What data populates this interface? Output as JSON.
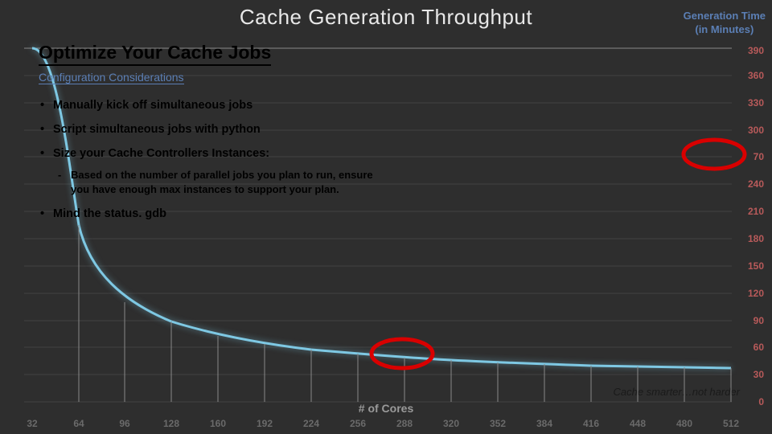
{
  "chart_data": {
    "type": "line",
    "title": "Cache Generation Throughput",
    "xlabel": "# of Cores",
    "ylabel": "Generation Time\n(in Minutes)",
    "x": [
      32,
      64,
      96,
      128,
      160,
      192,
      224,
      256,
      288,
      320,
      352,
      384,
      416,
      448,
      480,
      512
    ],
    "y_ticks": [
      0,
      30,
      60,
      90,
      120,
      150,
      180,
      210,
      240,
      270,
      300,
      330,
      360,
      390
    ],
    "ylim": [
      0,
      390
    ],
    "series": [
      {
        "name": "Generation Time",
        "x": [
          32,
          64,
          96,
          128,
          160,
          192,
          224,
          256,
          288,
          320,
          352,
          384,
          416,
          448,
          480,
          512
        ],
        "y": [
          390,
          195,
          140,
          110,
          92,
          80,
          72,
          66,
          61,
          57,
          54,
          51,
          48,
          46,
          44,
          42
        ]
      }
    ],
    "annotations": [
      {
        "shape": "ellipse",
        "approx_x": 256,
        "approx_y": 66
      },
      {
        "shape": "ellipse",
        "approx_x": 504,
        "approx_y": 270
      }
    ]
  },
  "overlay": {
    "title": "Optimize Your Cache Jobs",
    "subtitle": "Configuration Considerations",
    "bullets": [
      "Manually kick off simultaneous jobs",
      "Script simultaneous jobs with python",
      "Size your Cache Controllers Instances:",
      "Mind the status. gdb"
    ],
    "sub_bullet": "Based on the number of parallel jobs you plan to run, ensure you have enough max instances to support your plan."
  },
  "tagline": "Cache smarter…not harder",
  "axis_right_heading": "Generation Time",
  "axis_right_sub": "(in Minutes)",
  "accent_color": "#7ec8e3",
  "annotation_color": "#d90000",
  "ytick_270_display": "70"
}
